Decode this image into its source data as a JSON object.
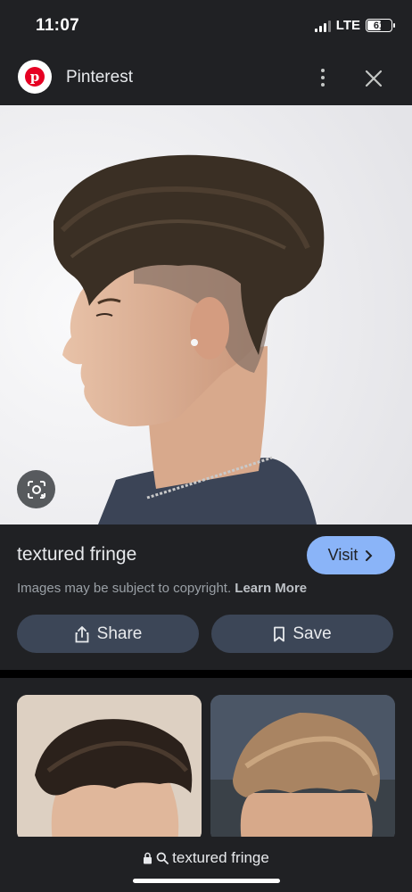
{
  "status_bar": {
    "time": "11:07",
    "network": "LTE",
    "battery": "61",
    "battery_level": 0.61
  },
  "header": {
    "site_name": "Pinterest",
    "logo_letter": "p",
    "more_icon": "more-vert-icon",
    "close_icon": "close-icon"
  },
  "main_image": {
    "description_icon": "google-lens-icon"
  },
  "result": {
    "title": "textured fringe",
    "visit_label": "Visit",
    "copyright_text": "Images may be subject to copyright.",
    "learn_more": "Learn More",
    "share_label": "Share",
    "save_label": "Save"
  },
  "bottom_bar": {
    "query": "textured fringe",
    "lock_icon": "lock-icon",
    "search_icon": "search-icon"
  },
  "colors": {
    "background": "#202124",
    "visit_button": "#8ab4f8",
    "action_button": "#3c4657",
    "pinterest_red": "#e60023"
  }
}
